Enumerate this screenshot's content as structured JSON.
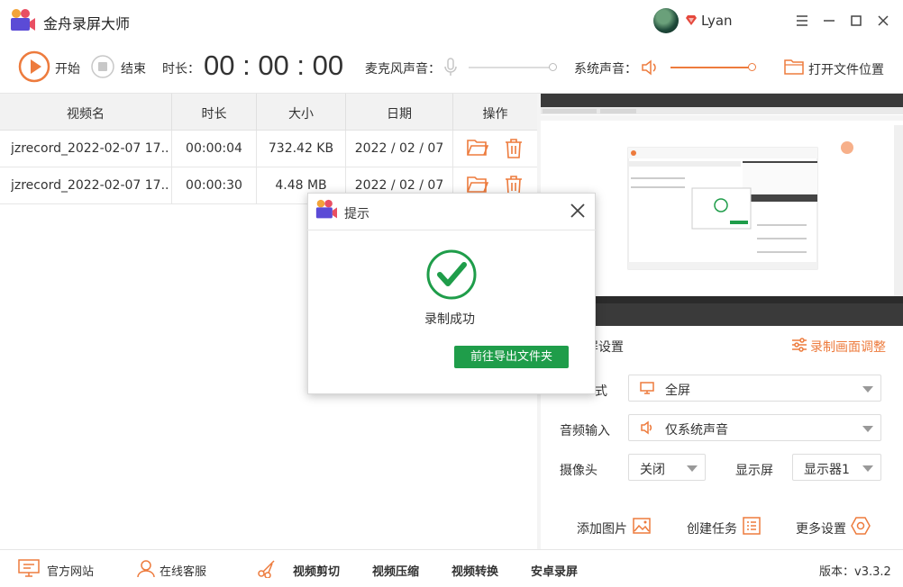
{
  "app": {
    "title": "金舟录屏大师",
    "user_name": "Lyan"
  },
  "toolbar": {
    "start_label": "开始",
    "stop_label": "结束",
    "duration_label": "时长：",
    "timer": "00 : 00 : 00",
    "mic_label": "麦克风声音：",
    "system_audio_label": "系统声音：",
    "open_folder_label": "打开文件位置"
  },
  "table": {
    "headers": [
      "视频名",
      "时长",
      "大小",
      "日期",
      "操作"
    ],
    "rows": [
      {
        "name": "jzrecord_2022-02-07 17...",
        "duration": "00:00:04",
        "size": "732.42 KB",
        "date": "2022 / 02 / 07"
      },
      {
        "name": "jzrecord_2022-02-07 17...",
        "duration": "00:00:30",
        "size": "4.48 MB",
        "date": "2022 / 02 / 07"
      }
    ]
  },
  "settings": {
    "title": "屏设置",
    "adjust_label": "录制画面调整",
    "mode_label": "式",
    "mode_value": "全屏",
    "audio_label": "音频输入",
    "audio_value": "仅系统声音",
    "camera_label": "摄像头",
    "camera_value": "关闭",
    "display_label": "显示屏",
    "display_value": "显示器1",
    "add_image_label": "添加图片",
    "create_task_label": "创建任务",
    "more_settings_label": "更多设置"
  },
  "footer": {
    "website": "官方网站",
    "support": "在线客服",
    "video_cut": "视频剪切",
    "video_compress": "视频压缩",
    "video_convert": "视频转换",
    "android_record": "安卓录屏",
    "version": "版本：v3.3.2"
  },
  "dialog": {
    "title": "提示",
    "message": "录制成功",
    "button_label": "前往导出文件夹"
  },
  "colors": {
    "accent": "#ed7b3d",
    "success": "#1f9d4a"
  }
}
